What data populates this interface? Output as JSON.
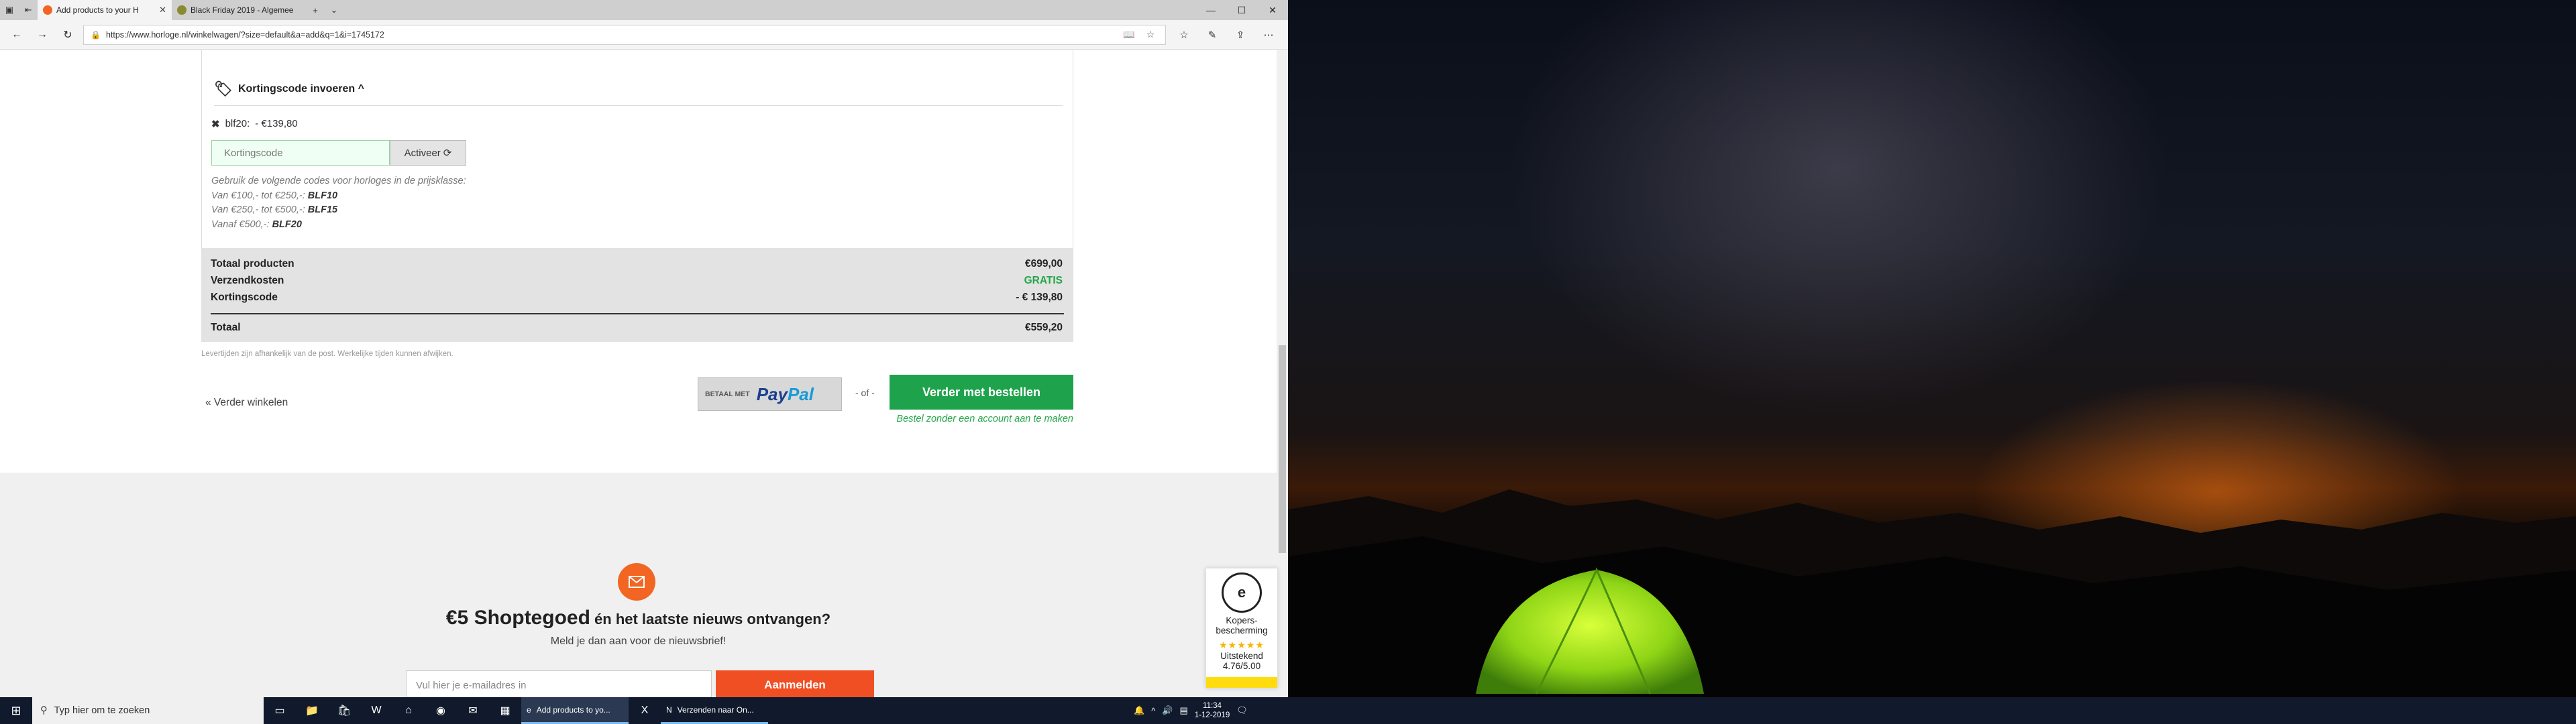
{
  "browser": {
    "tabs": [
      {
        "label": "Add products to your H",
        "active": true,
        "favicon_color": "#f26522"
      },
      {
        "label": "Black Friday 2019 - Algemee",
        "active": false,
        "favicon_color": "#8a8a30"
      }
    ],
    "url": "https://www.horloge.nl/winkelwagen/?size=default&a=add&q=1&i=1745172"
  },
  "coupon": {
    "heading": "Kortingscode invoeren ^",
    "applied_code": "blf20:",
    "applied_amount": "- €139,80",
    "placeholder": "Kortingscode",
    "activate_label": "Activeer",
    "hint_line1": "Gebruik de volgende codes voor horloges in de prijsklasse:",
    "hint_rows": [
      {
        "range": "Van €100,- tot €250,-: ",
        "code": "BLF10"
      },
      {
        "range": "Van €250,- tot €500,-: ",
        "code": "BLF15"
      },
      {
        "range": "Vanaf €500,-: ",
        "code": "BLF20"
      }
    ]
  },
  "totals": {
    "products_label": "Totaal producten",
    "products_value": "€699,00",
    "shipping_label": "Verzendkosten",
    "shipping_value": "GRATIS",
    "discount_label": "Kortingscode",
    "discount_value": "- € 139,80",
    "total_label": "Totaal",
    "total_value": "€559,20",
    "delivery_note": "Levertijden zijn afhankelijk van de post. Werkelijke tijden kunnen afwijken."
  },
  "actions": {
    "continue_label": "« Verder winkelen",
    "paypal_prefix": "BETAAL MET",
    "paypal_pay": "Pay",
    "paypal_pal": "Pal",
    "or_label": "- of -",
    "order_label": "Verder met bestellen",
    "guest_label": "Bestel zonder een account aan te maken"
  },
  "newsletter": {
    "title_big": "€5 Shoptegoed",
    "title_rest": "én het laatste nieuws ontvangen?",
    "subtitle": "Meld je dan aan voor de nieuwsbrief!",
    "placeholder": "Vul hier je e-mailadres in",
    "button_label": "Aanmelden"
  },
  "trust": {
    "seal": "e",
    "label": "Kopers-bescherming",
    "stars": "★★★★★",
    "rating_word": "Uitstekend",
    "rating": "4.76/5.00"
  },
  "taskbar": {
    "search_placeholder": "Typ hier om te zoeken",
    "apps": [
      {
        "label": "Add products to yo...",
        "active": true
      },
      {
        "label": "Verzenden naar On...",
        "active": false
      }
    ],
    "time": "11:34",
    "date": "1-12-2019"
  }
}
